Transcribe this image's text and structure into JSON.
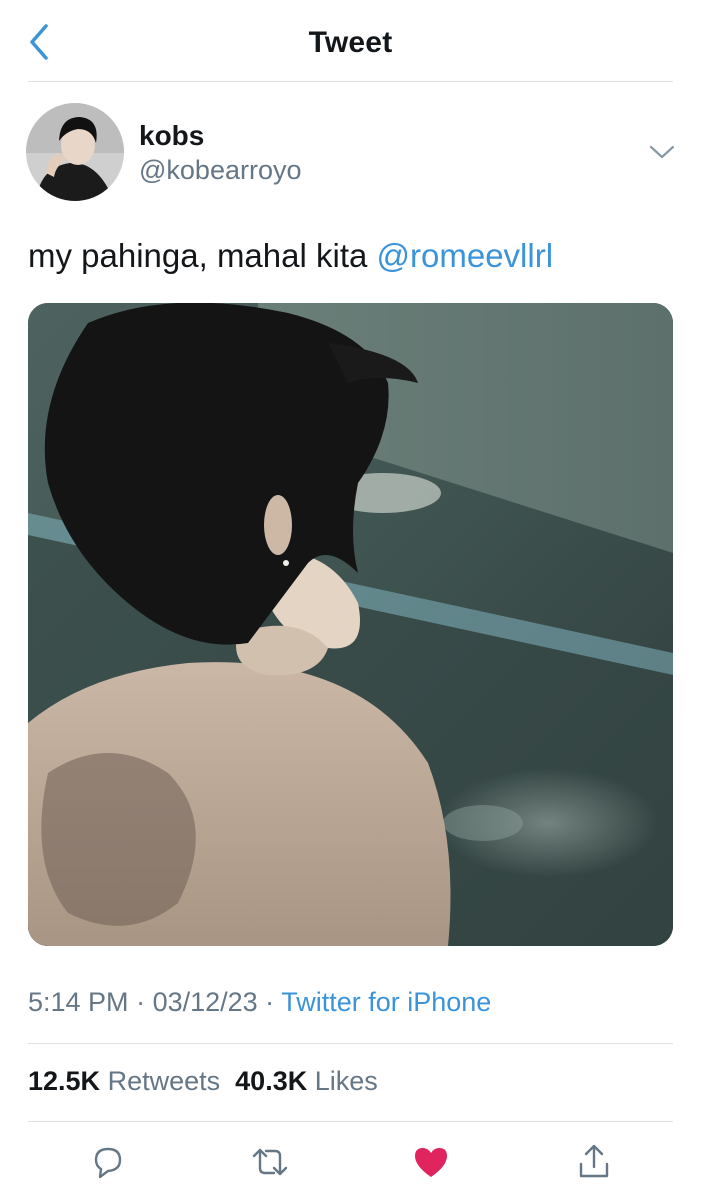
{
  "nav": {
    "title": "Tweet",
    "back_icon": "chevron-left-icon"
  },
  "tweet": {
    "author": {
      "name": "kobs",
      "handle": "@kobearroyo"
    },
    "text": "my pahinga, mahal kita ",
    "mention": "@romeevllrl",
    "meta": {
      "time": "5:14 PM",
      "separator": " · ",
      "date": "03/12/23",
      "source": "Twitter for iPhone"
    },
    "stats": {
      "retweets_count": "12.5K",
      "retweets_label": "Retweets",
      "likes_count": "40.3K",
      "likes_label": "Likes"
    },
    "liked": true
  },
  "colors": {
    "accent": "#3b94d9",
    "like": "#e0245e",
    "muted": "#657786",
    "text": "#14171a"
  },
  "icons": [
    "chevron-left-icon",
    "chevron-down-icon",
    "reply-icon",
    "retweet-icon",
    "heart-icon",
    "share-icon"
  ]
}
